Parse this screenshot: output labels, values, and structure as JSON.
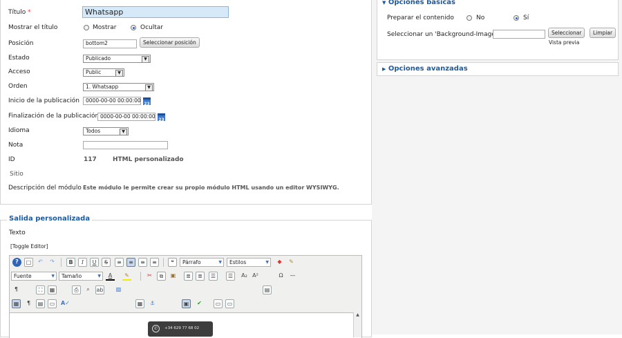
{
  "form": {
    "title_label": "Título",
    "required_mark": "*",
    "title_value": "Whatsapp",
    "show_title_label": "Mostrar el título",
    "show_title_opt_show": "Mostrar",
    "show_title_opt_hide": "Ocultar",
    "position_label": "Posición",
    "position_value": "bottom2",
    "select_position_btn": "Seleccionar posición",
    "state_label": "Estado",
    "state_value": "Publicado",
    "access_label": "Acceso",
    "access_value": "Public",
    "order_label": "Orden",
    "order_value": "1. Whatsapp",
    "publish_start_label": "Inicio de la publicación",
    "publish_start_value": "0000-00-00 00:00:00",
    "publish_end_label": "Finalización de la publicación",
    "publish_end_value": "0000-00-00 00:00:00",
    "calendar_day": "23",
    "language_label": "Idioma",
    "language_value": "Todos",
    "note_label": "Nota",
    "note_value": "",
    "id_label": "ID",
    "id_value": "117",
    "id_type": "HTML personalizado",
    "site_label": "Sitio",
    "description_label": "Descripción del módulo",
    "description_value": "Este módulo le permite crear su propio módulo HTML usando un editor WYSIWYG."
  },
  "custom_output": {
    "title": "Salida personalizada",
    "text_label": "Texto",
    "toggle_editor": "[Toggle Editor]",
    "format_select": "Párrafo",
    "styles_select": "Estilos",
    "font_select": "Fuente",
    "size_select": "Tamaño",
    "preview_phone": "+34 629 77 68 02"
  },
  "basic_options": {
    "title": "Opciones básicas",
    "prepare_content_label": "Preparar el contenido",
    "opt_no": "No",
    "opt_yes": "Sí",
    "bg_image_label": "Seleccionar un 'Background-Image'",
    "bg_image_value": "",
    "select_btn": "Seleccionar",
    "clear_btn": "Limpiar",
    "preview_label": "Vista previa"
  },
  "advanced_options": {
    "title": "Opciones avanzadas"
  },
  "colors": {
    "accent": "#1d5a9d",
    "title_input_bg": "#d6e9f8"
  }
}
